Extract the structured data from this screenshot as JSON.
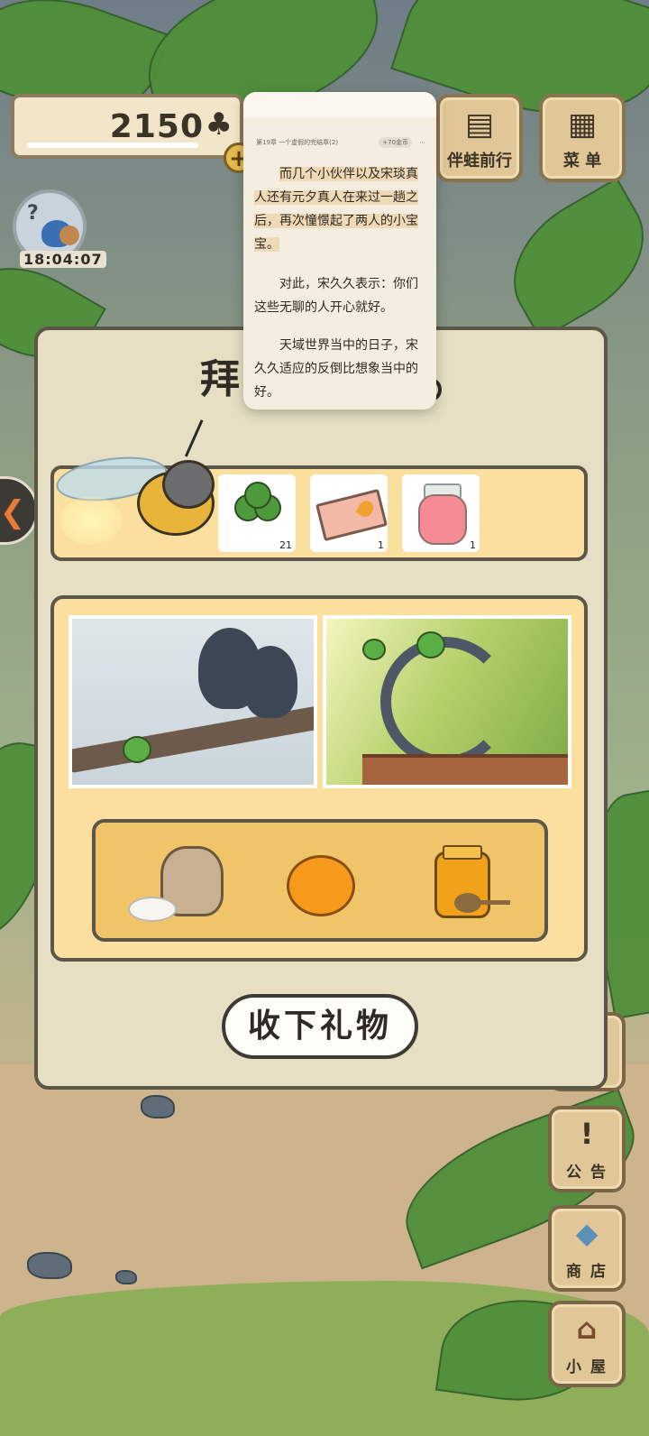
{
  "hud": {
    "clover_count": "2150",
    "clover_symbol": "♣",
    "plus_label": "+",
    "avatar_question": "?",
    "clock": "18:04:07"
  },
  "top_buttons": [
    {
      "label": "伴蛙前行",
      "icon": "book-icon"
    },
    {
      "label": "菜 单",
      "icon": "menu-icon"
    }
  ],
  "side_buttons": [
    {
      "label": "公 告",
      "glyph": "!",
      "icon": "notice-icon"
    },
    {
      "label": "商 店",
      "glyph": "◆",
      "icon": "shop-icon"
    },
    {
      "label": "小 屋",
      "glyph": "⌂",
      "icon": "house-icon"
    }
  ],
  "left_arrow": "❮",
  "panel": {
    "title": "拜",
    "rewards": [
      {
        "name": "clover",
        "qty": "21"
      },
      {
        "name": "ticket",
        "qty": "1"
      },
      {
        "name": "jam-jar",
        "qty": "1"
      }
    ],
    "food": [
      "rice-sack",
      "orange",
      "honey-jar"
    ],
    "accept_button": "收下礼物"
  },
  "reader": {
    "chapter": "第19章 一个虚假的完结章(2)",
    "coins": "+70金币",
    "more": "⋯",
    "paragraph1_hl": "而几个小伙伴以及宋琰真人还有元夕真人在来过一趟之后，再次憧憬起了两人的小宝宝。",
    "paragraph2": "对此，宋久久表示：你们这些无聊的人开心就好。",
    "paragraph3": "天域世界当中的日子，宋久久适应的反倒比想象当中的好。"
  },
  "colors": {
    "panel_bg": "#e7dfc3",
    "reward_bg": "#fbdf9f",
    "tray_bg": "#f0c56a",
    "button_wood": "#e1c797"
  }
}
